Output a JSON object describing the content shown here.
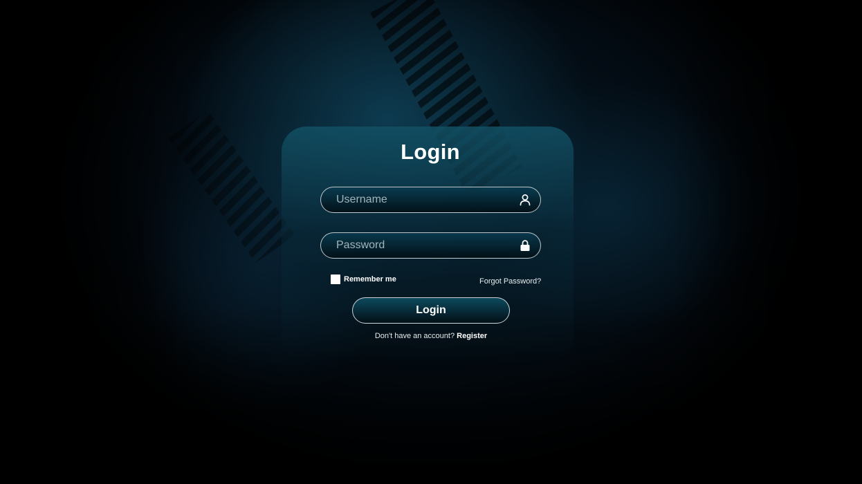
{
  "form": {
    "title": "Login",
    "username": {
      "placeholder": "Username",
      "icon": "user-icon"
    },
    "password": {
      "placeholder": "Password",
      "icon": "lock-icon"
    },
    "remember_label": "Remember me",
    "remember_checked": false,
    "forgot_label": "Forgot Password?",
    "submit_label": "Login",
    "register_prompt": "Don't have an account?",
    "register_link": "Register"
  },
  "colors": {
    "accent": "#145a78",
    "text": "#ffffff",
    "background": "#000000"
  }
}
